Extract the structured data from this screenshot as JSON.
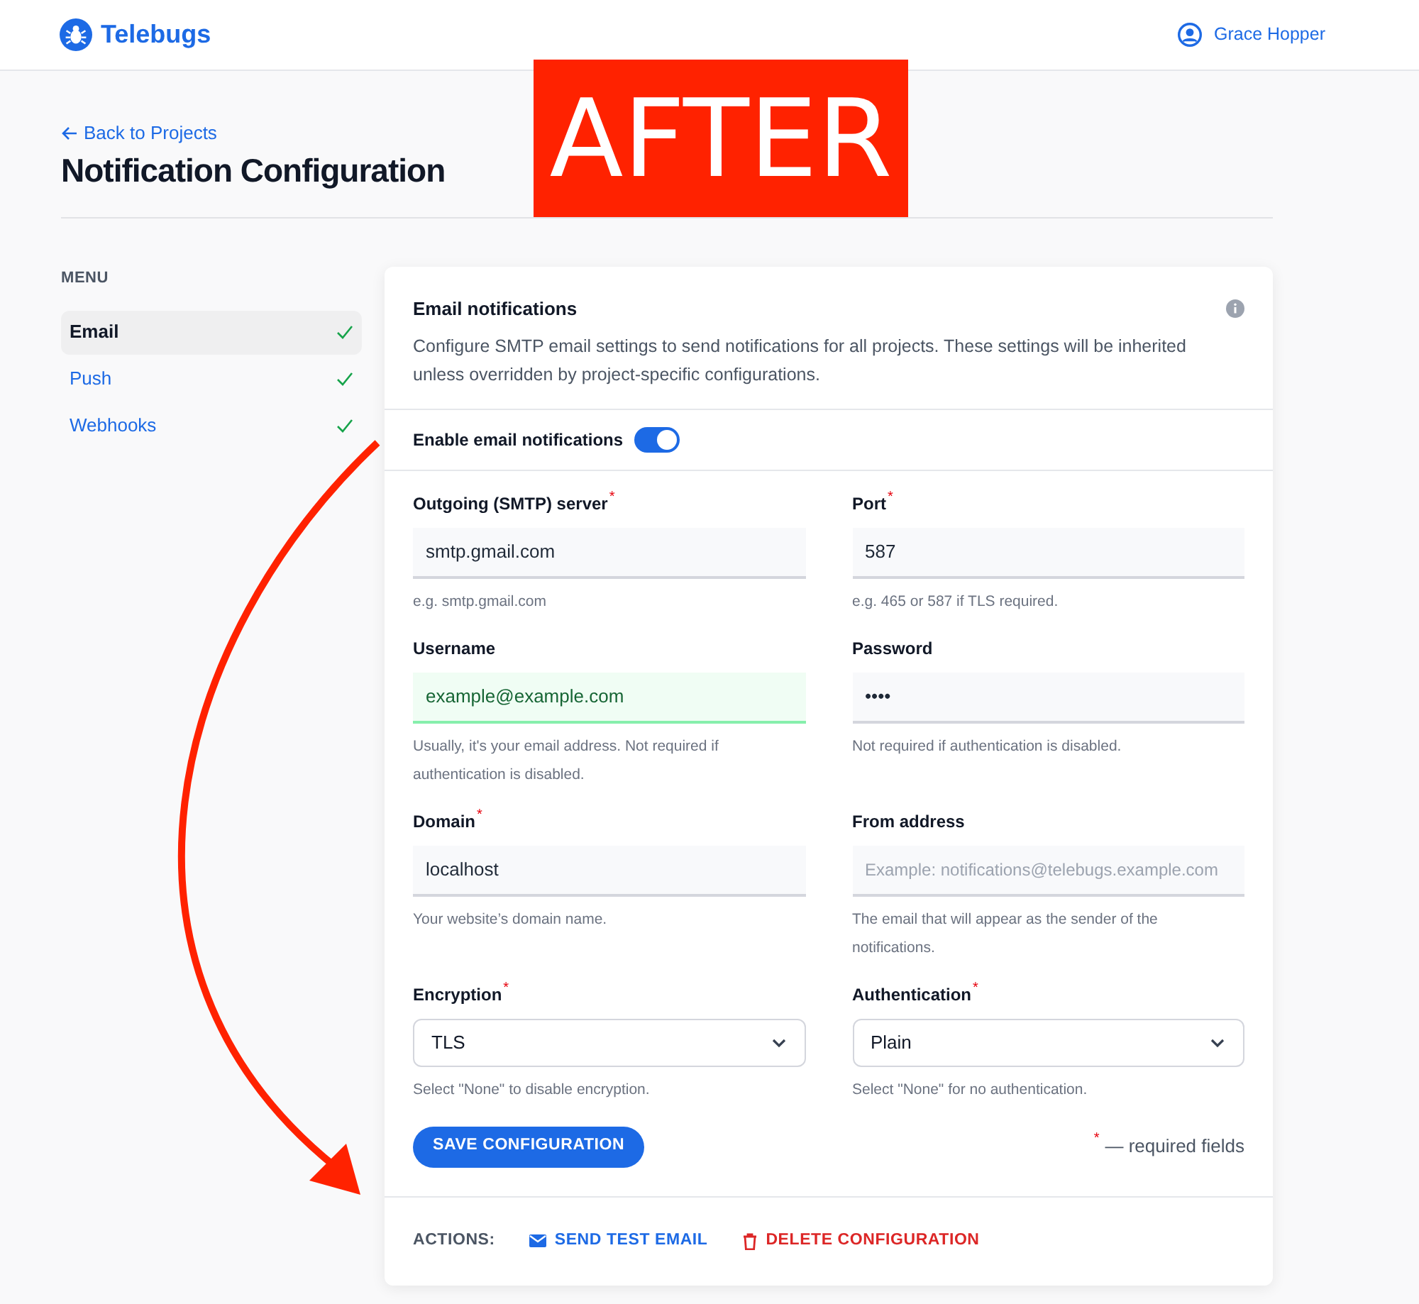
{
  "header": {
    "brand": "Telebugs",
    "user": "Grace Hopper"
  },
  "page": {
    "back_link": "Back to Projects",
    "title": "Notification Configuration"
  },
  "annotation": {
    "label": "AFTER"
  },
  "sidebar": {
    "heading": "MENU",
    "items": [
      {
        "label": "Email",
        "selected": true,
        "checked": true
      },
      {
        "label": "Push",
        "selected": false,
        "checked": true
      },
      {
        "label": "Webhooks",
        "selected": false,
        "checked": true
      }
    ]
  },
  "card": {
    "title": "Email notifications",
    "description": "Configure SMTP email settings to send notifications for all projects. These settings will be inherited unless overridden by project-specific configurations.",
    "toggle": {
      "label": "Enable email notifications",
      "on": true
    },
    "fields": [
      {
        "kind": "text",
        "label": "Outgoing (SMTP) server",
        "required_mark": "*",
        "value": "smtp.gmail.com",
        "hint": "e.g. smtp.gmail.com",
        "valid": false
      },
      {
        "kind": "text",
        "label": "Port",
        "required_mark": "*",
        "value": "587",
        "hint": "e.g. 465 or 587 if TLS required.",
        "valid": false
      },
      {
        "kind": "text",
        "label": "Username",
        "value": "example@example.com",
        "hint": "Usually, it's your email address. Not required if authentication is disabled.",
        "valid": true
      },
      {
        "kind": "text",
        "label": "Password",
        "value": "••••",
        "hint": "Not required if authentication is disabled.",
        "valid": false
      },
      {
        "kind": "text",
        "label": "Domain",
        "required_mark": "*",
        "value": "localhost",
        "hint": "Your website’s domain name.",
        "valid": false
      },
      {
        "kind": "text",
        "label": "From address",
        "placeholder": "Example: notifications@telebugs.example.com",
        "hint": "The email that will appear as the sender of the notifications.",
        "valid": false
      },
      {
        "kind": "select",
        "label": "Encryption",
        "required_mark": "*",
        "value": "TLS",
        "hint": "Select \"None\" to disable encryption."
      },
      {
        "kind": "select",
        "label": "Authentication",
        "required_mark": "*",
        "value": "Plain",
        "hint": "Select \"None\" for no authentication."
      }
    ],
    "save_button": "SAVE CONFIGURATION",
    "required_note_mark": "*",
    "required_note": "— required fields",
    "actions": {
      "label": "ACTIONS:",
      "items": [
        {
          "kind": "send",
          "label": "SEND TEST EMAIL"
        },
        {
          "kind": "delete",
          "label": "DELETE CONFIGURATION"
        }
      ]
    }
  }
}
